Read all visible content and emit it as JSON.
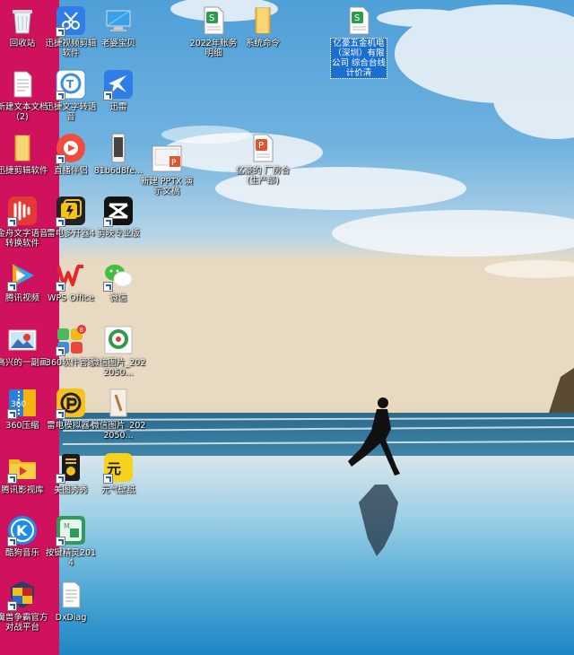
{
  "desktop": {
    "icons": [
      {
        "label": "回收站"
      },
      {
        "label": "迅捷视频剪辑软件"
      },
      {
        "label": "老婆宝贝"
      },
      {
        "label": "2022年账务明细"
      },
      {
        "label": "系统命令"
      },
      {
        "label": "亿豪五金机电（深圳）有限公司 综合台线计价清"
      },
      {
        "label": "新建文本文档 (2)"
      },
      {
        "label": "迅捷文字转语音"
      },
      {
        "label": "迅雷"
      },
      {
        "label": "迅捷剪辑软件"
      },
      {
        "label": "直播伴侣"
      },
      {
        "label": "81b6d8fe..."
      },
      {
        "label": "新建 PPTX 演示文稿"
      },
      {
        "label": "亿豪的 厂房合 (生产部)"
      },
      {
        "label": "金舟文字语音转换软件"
      },
      {
        "label": "雷电多开器4"
      },
      {
        "label": "剪映专业版"
      },
      {
        "label": "腾讯视频"
      },
      {
        "label": "WPS Office"
      },
      {
        "label": "微信"
      },
      {
        "label": "高兴的一副画"
      },
      {
        "label": "360软件管家"
      },
      {
        "label": "微信图片_2022050..."
      },
      {
        "label": "360压缩"
      },
      {
        "label": "雷电模拟器4"
      },
      {
        "label": "微信图片_2022050..."
      },
      {
        "label": "腾讯影视库"
      },
      {
        "label": "美图秀秀"
      },
      {
        "label": "元气壁纸"
      },
      {
        "label": "酷狗音乐"
      },
      {
        "label": "按键精灵2014"
      },
      {
        "label": "魔兽争霸官方对战平台"
      },
      {
        "label": "DxDiag"
      }
    ]
  }
}
